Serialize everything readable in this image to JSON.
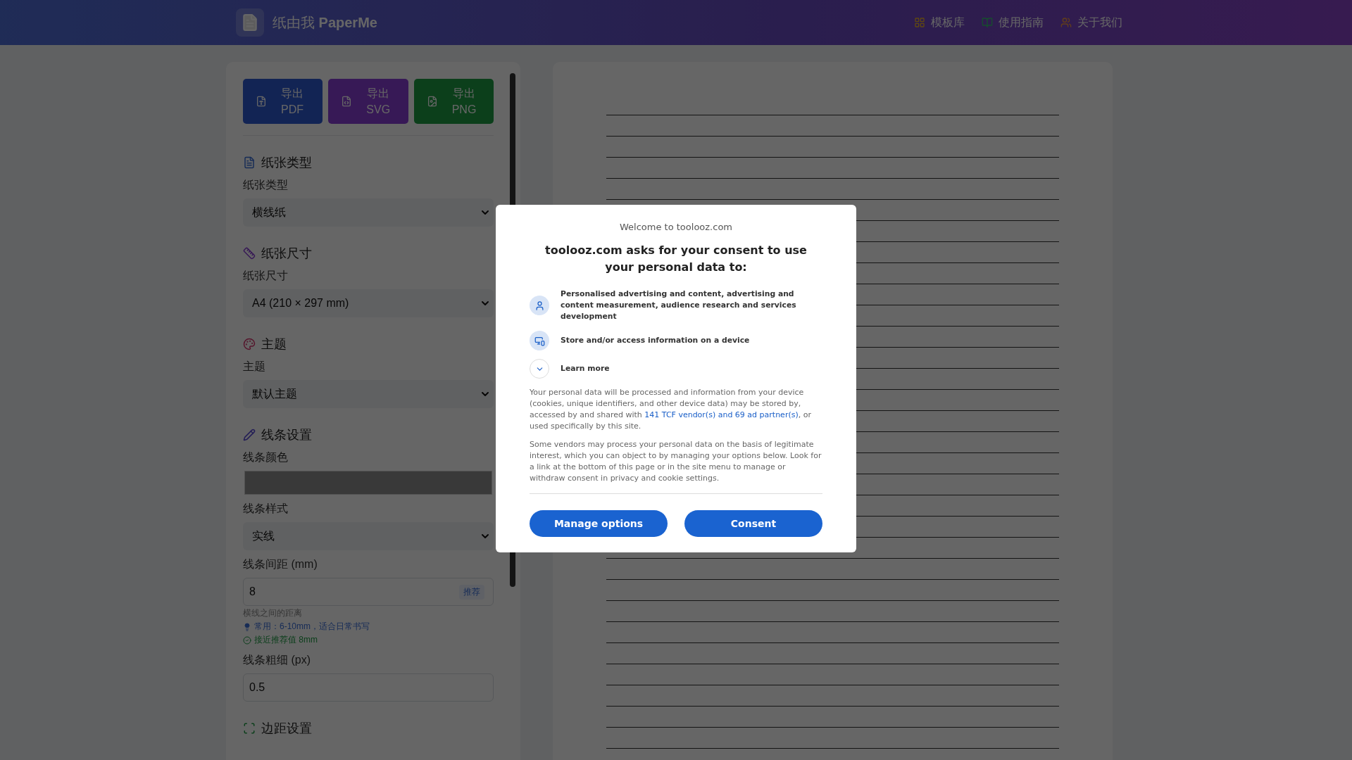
{
  "header": {
    "logo": "纸由我 **PaperMe**",
    "nav": [
      {
        "label": "模板库",
        "kind": "grid"
      },
      {
        "label": "使用指南",
        "kind": "book"
      },
      {
        "label": "关于我们",
        "kind": "users"
      }
    ]
  },
  "export_buttons": [
    {
      "line1": "导出",
      "line2": "PDF"
    },
    {
      "line1": "导出",
      "line2": "SVG"
    },
    {
      "line1": "导出",
      "line2": "PNG"
    }
  ],
  "sections": [
    {
      "title": "纸张类型",
      "kind": "file",
      "fields": [
        {
          "kind": "select",
          "label": "纸张类型",
          "value": "横线纸"
        }
      ]
    },
    {
      "title": "纸张尺寸",
      "kind": "ruler",
      "fields": [
        {
          "kind": "select",
          "label": "纸张尺寸",
          "value": "A4 (210 × 297 mm)"
        }
      ]
    },
    {
      "title": "主题",
      "kind": "palette",
      "fields": [
        {
          "kind": "select",
          "label": "主题",
          "value": "默认主题"
        }
      ]
    },
    {
      "title": "线条设置",
      "kind": "pencil",
      "fields": [
        {
          "kind": "color",
          "label": "线条颜色"
        },
        {
          "kind": "select",
          "label": "线条样式",
          "value": "实线"
        },
        {
          "kind": "input",
          "label": "线条间距 (mm)",
          "value": "8",
          "badge": "推荐",
          "hints": [
            {
              "kind": "plain",
              "text": "横线之间的距离"
            },
            {
              "kind": "tip",
              "text": "常用：6-10mm，适合日常书写"
            },
            {
              "kind": "ok",
              "text": "接近推荐值 8mm"
            }
          ]
        },
        {
          "kind": "input",
          "label": "线条粗细 (px)",
          "value": "0.5"
        }
      ]
    },
    {
      "title": "边距设置",
      "kind": "expand"
    }
  ],
  "consent": {
    "site": "Welcome to toolooz.com",
    "title": "toolooz.com asks for your consent to use your personal data to:",
    "purposes": [
      {
        "kind": "person",
        "text": "Personalised advertising and content, advertising and content measurement, audience research and services development"
      },
      {
        "kind": "device",
        "text": "Store and/or access information on a device"
      }
    ],
    "learn_more": {
      "label": "Learn more",
      "expanded": false
    },
    "paragraph_1": {
      "before": "Your personal data will be processed and information from your device (cookies, unique identifiers, and other device data) may be stored by, accessed by and shared with ",
      "link": "141 TCF vendor(s) and 69 ad partner(s)",
      "after": ", or used specifically by this site."
    },
    "paragraph_2": "Some vendors may process your personal data on the basis of legitimate interest, which you can object to by managing your options below. Look for a link at the bottom of this page or in the site menu to manage or withdraw consent in privacy and cookie settings.",
    "buttons": [
      "Manage options",
      "Consent"
    ]
  }
}
